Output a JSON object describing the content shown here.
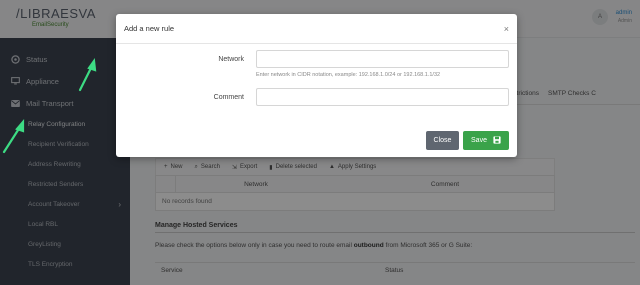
{
  "logo": {
    "main": "/LIBRAESVA",
    "sub": "EmailSecurity"
  },
  "sidebar": {
    "top_items": [
      {
        "label": "Status",
        "icon": "status-icon"
      },
      {
        "label": "Appliance",
        "icon": "monitor-icon"
      },
      {
        "label": "Mail Transport",
        "icon": "mail-icon"
      }
    ],
    "sub_items": [
      {
        "label": "Relay Configuration"
      },
      {
        "label": "Recipient Verification"
      },
      {
        "label": "Address Rewriting"
      },
      {
        "label": "Restricted Senders"
      },
      {
        "label": "Account Takeover"
      },
      {
        "label": "Local RBL"
      },
      {
        "label": "GreyListing"
      },
      {
        "label": "TLS Encryption"
      }
    ]
  },
  "user": {
    "initial": "A",
    "name": "admin",
    "role": "Admin"
  },
  "page_tabs": [
    "Restrictions",
    "SMTP Checks C"
  ],
  "toolbar": {
    "new": "New",
    "search": "Search",
    "export": "Export",
    "delete": "Delete selected",
    "apply": "Apply Settings"
  },
  "grid": {
    "col_network": "Network",
    "col_comment": "Comment",
    "empty": "No records found"
  },
  "hosted": {
    "title": "Manage Hosted Services",
    "desc_before": "Please check the options below only in case you need to route email ",
    "desc_bold": "outbound",
    "desc_after": " from Microsoft 365 or G Suite:",
    "col_service": "Service",
    "col_status": "Status"
  },
  "modal": {
    "title": "Add a new rule",
    "close_glyph": "×",
    "network_label": "Network",
    "network_value": "",
    "network_help": "Enter network in CIDR notation, example: 192.168.1.0/24 or 192.168.1.1/32",
    "comment_label": "Comment",
    "comment_value": "",
    "close_button": "Close",
    "save_button": "Save"
  },
  "colors": {
    "save": "#3aa34a",
    "close": "#5f6670",
    "sidebar": "#3d4450",
    "arrow": "#3ddc84"
  }
}
